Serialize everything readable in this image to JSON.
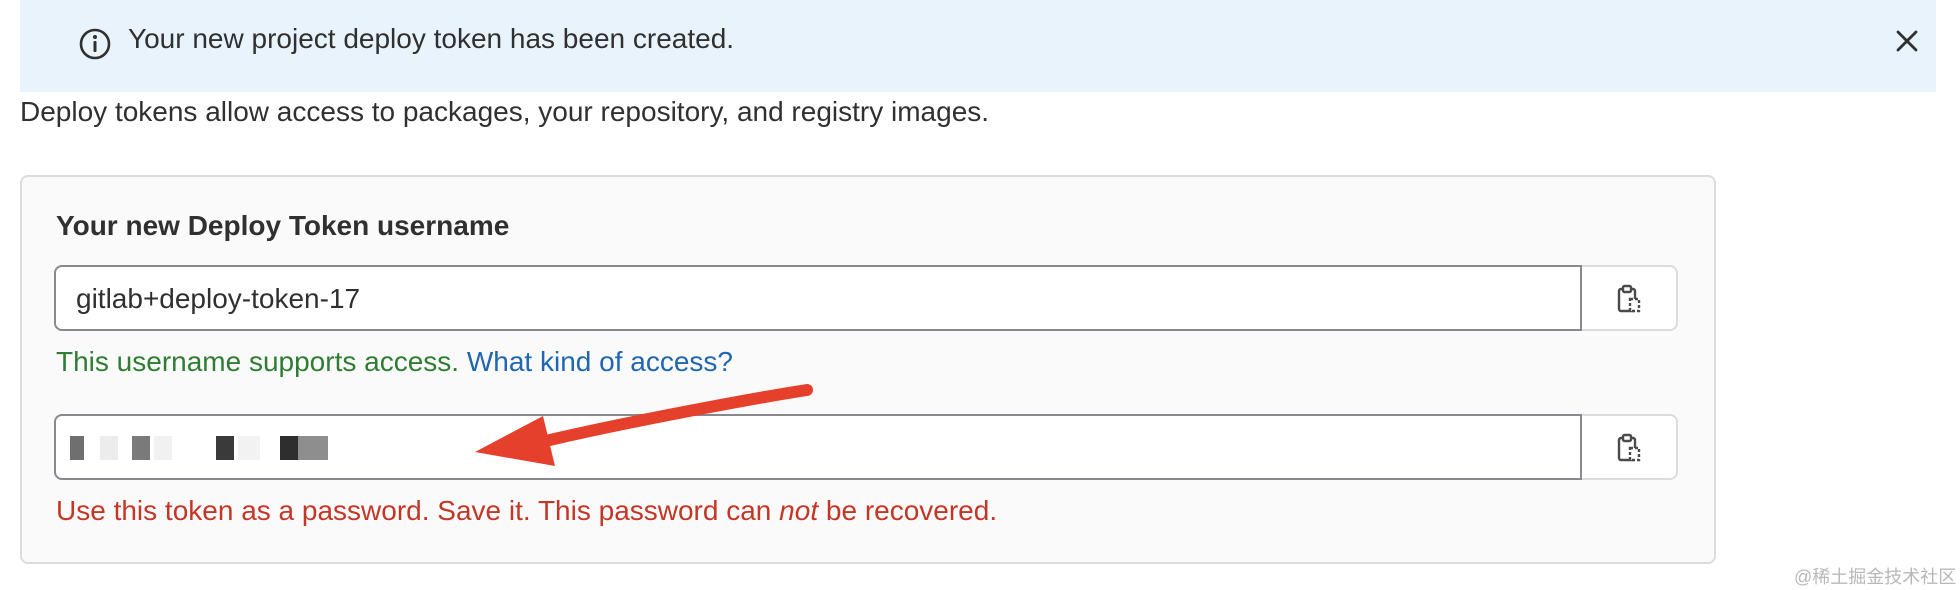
{
  "alert": {
    "message": "Your new project deploy token has been created.",
    "icon": "info-icon",
    "close_icon": "close-icon",
    "background": "#e9f3fc"
  },
  "description": "Deploy tokens allow access to packages, your repository, and registry images.",
  "card": {
    "title": "Your new Deploy Token username",
    "username_value": "gitlab+deploy-token-17",
    "username_help_text": "This username supports access.",
    "username_help_link": "What kind of access?",
    "password_help_before": "Use this token as a password. Save it. This password can ",
    "password_help_emphasis": "not",
    "password_help_after": " be recovered.",
    "copy_icon": "clipboard-copy-icon"
  },
  "colors": {
    "success": "#2f7d32",
    "link": "#1f66b3",
    "danger": "#c43626",
    "annotation_arrow": "#e5402c"
  },
  "watermark": "@稀土掘金技术社区"
}
